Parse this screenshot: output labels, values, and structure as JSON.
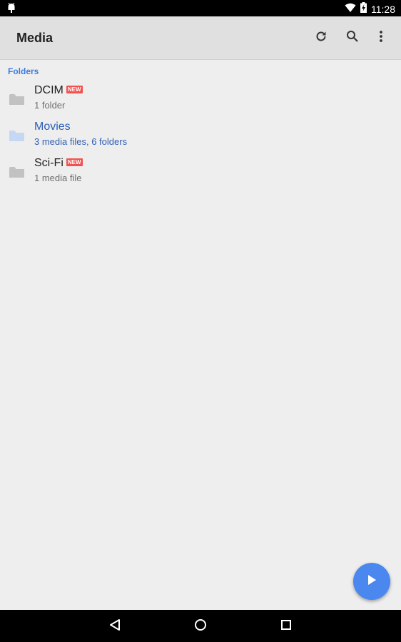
{
  "status_bar": {
    "time": "11:28",
    "icons": [
      "android-icon",
      "wifi-icon",
      "battery-charging-icon"
    ]
  },
  "app_bar": {
    "title": "Media",
    "actions": [
      "refresh-icon",
      "search-icon",
      "more-vert-icon"
    ]
  },
  "section": {
    "header": "Folders"
  },
  "folders": [
    {
      "name": "DCIM",
      "meta": "1 folder",
      "badge": "NEW"
    },
    {
      "name": "Movies",
      "meta": "3 media files, 6 folders",
      "badge": ""
    },
    {
      "name": "Sci-Fi",
      "meta": "1 media file",
      "badge": "NEW"
    }
  ],
  "fab": {
    "icon": "play-icon"
  },
  "nav_bar": {
    "icons": [
      "back-icon",
      "home-icon",
      "recents-icon"
    ]
  },
  "colors": {
    "accent": "#4a88f0",
    "section_header": "#3d7be0",
    "selected_text": "#2f5fb3",
    "badge": "#ef5350",
    "app_bar": "#e0e0e0",
    "background": "#eeeeee"
  }
}
